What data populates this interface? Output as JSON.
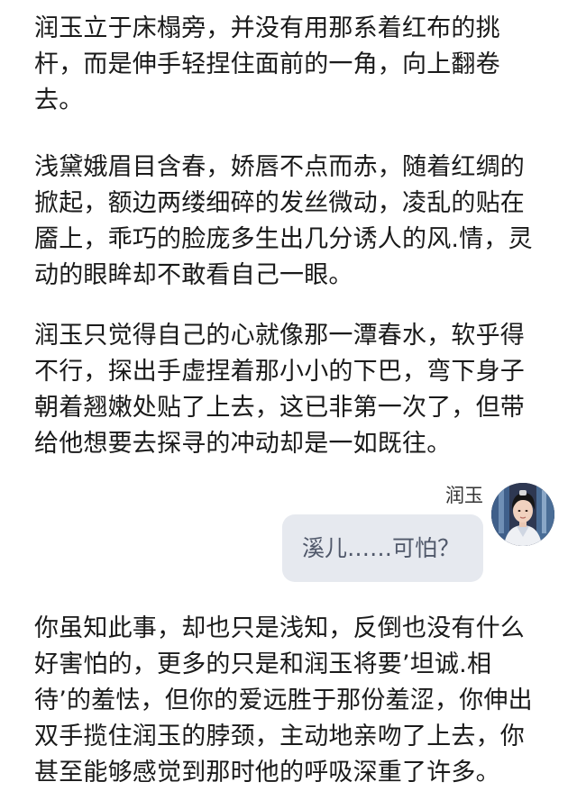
{
  "story": {
    "paragraph_1": "润玉立于床榻旁，并没有用那系着红布的挑杆，而是伸手轻捏住面前的一角，向上翻卷去。",
    "paragraph_2": "浅黛娥眉目含春，娇唇不点而赤，随着红绸的掀起，额边两缕细碎的发丝微动，凌乱的贴在靥上，乖巧的脸庞多生出几分诱人的风.情，灵动的眼眸却不敢看自己一眼。",
    "paragraph_3": "润玉只觉得自己的心就像那一潭春水，软乎得不行，探出手虚捏着那小小的下巴，弯下身子朝着翘嫩处贴了上去，这已非第一次了，但带给他想要去探寻的冲动却是一如既往。",
    "paragraph_4": "你虽知此事，却也只是浅知，反倒也没有什么好害怕的，更多的只是和润玉将要’坦诚.相待’的羞怯，但你的爱远胜于那份羞涩，你伸出双手揽住润玉的脖颈，主动地亲吻了上去，你甚至能够感觉到那时他的呼吸深重了许多。"
  },
  "dialogue": {
    "speaker_name": "润玉",
    "message": "溪儿……可怕？",
    "avatar_icon": "character-portrait-avatar",
    "bubble_color": "#e6e9ef"
  }
}
